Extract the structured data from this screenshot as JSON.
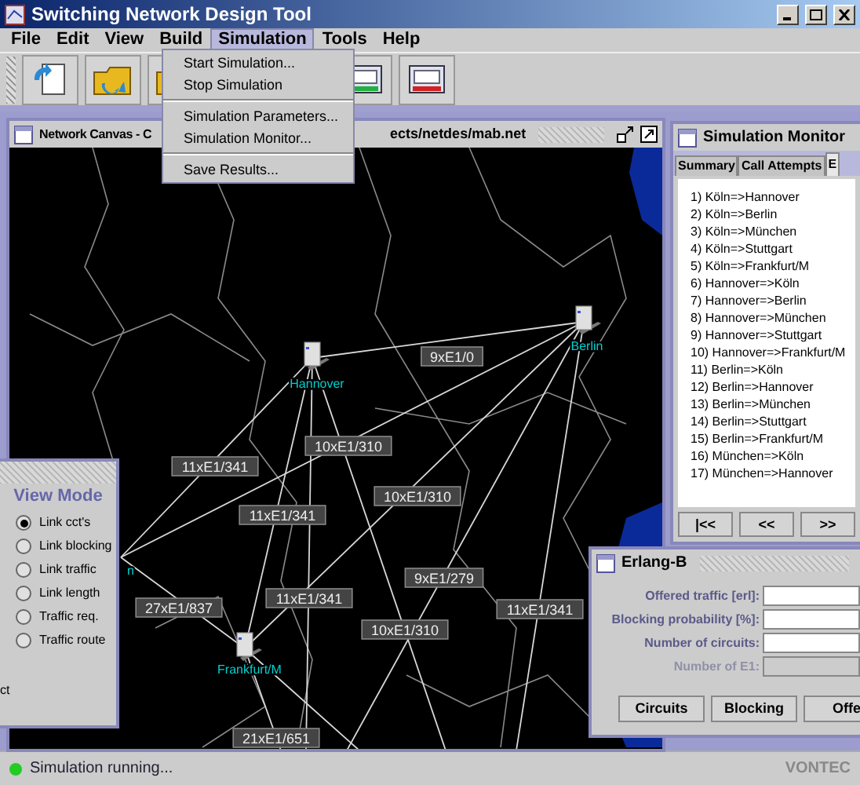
{
  "window": {
    "title": "Switching Network Design Tool"
  },
  "menu": [
    {
      "label": "File",
      "selected": false
    },
    {
      "label": "Edit",
      "selected": false
    },
    {
      "label": "View",
      "selected": false
    },
    {
      "label": "Build",
      "selected": false
    },
    {
      "label": "Simulation",
      "selected": true
    },
    {
      "label": "Tools",
      "selected": false
    },
    {
      "label": "Help",
      "selected": false
    }
  ],
  "open_menu": [
    {
      "kind": "item",
      "label": "Start Simulation..."
    },
    {
      "kind": "item",
      "label": "Stop Simulation"
    },
    {
      "kind": "separator"
    },
    {
      "kind": "item",
      "label": "Simulation Parameters..."
    },
    {
      "kind": "item",
      "label": "Simulation Monitor..."
    },
    {
      "kind": "separator"
    },
    {
      "kind": "item",
      "label": "Save Results..."
    }
  ],
  "canvas": {
    "title_start": "Network Canvas - C",
    "title_end": "ects/netdes/mab.net",
    "nodes": [
      {
        "label": "Hannover"
      },
      {
        "label": "Berlin"
      },
      {
        "label": "Frankfurt/M"
      },
      {
        "label": "n"
      }
    ],
    "links": [
      {
        "label": "9xE1/0"
      },
      {
        "label": "10xE1/310"
      },
      {
        "label": "11xE1/341"
      },
      {
        "label": "10xE1/310"
      },
      {
        "label": "11xE1/341"
      },
      {
        "label": "9xE1/279"
      },
      {
        "label": "27xE1/837"
      },
      {
        "label": "11xE1/341"
      },
      {
        "label": "11xE1/341"
      },
      {
        "label": "10xE1/310"
      },
      {
        "label": "21xE1/651"
      }
    ]
  },
  "monitor": {
    "title": "Simulation Monitor",
    "tabs": [
      {
        "label": "Summary",
        "selected": false
      },
      {
        "label": "Call Attempts",
        "selected": false
      },
      {
        "label": "E",
        "selected": true
      }
    ],
    "routes": [
      "1) Köln=>Hannover",
      "2) Köln=>Berlin",
      "3) Köln=>München",
      "4) Köln=>Stuttgart",
      "5) Köln=>Frankfurt/M",
      "6) Hannover=>Köln",
      "7) Hannover=>Berlin",
      "8) Hannover=>München",
      "9) Hannover=>Stuttgart",
      "10) Hannover=>Frankfurt/M",
      "11) Berlin=>Köln",
      "12) Berlin=>Hannover",
      "13) Berlin=>München",
      "14) Berlin=>Stuttgart",
      "15) Berlin=>Frankfurt/M",
      "16) München=>Köln",
      "17) München=>Hannover"
    ],
    "nav_buttons": [
      "|<<",
      "<<",
      ">>"
    ]
  },
  "view_mode": {
    "title": "View Mode",
    "options": [
      {
        "label": "Link cct's",
        "selected": true
      },
      {
        "label": "Link blocking",
        "selected": false
      },
      {
        "label": "Link traffic",
        "selected": false
      },
      {
        "label": "Link length",
        "selected": false
      },
      {
        "label": "Traffic req.",
        "selected": false
      },
      {
        "label": "Traffic route",
        "selected": false
      }
    ],
    "footer": "ct"
  },
  "erlang": {
    "title": "Erlang-B",
    "fields": [
      {
        "label": "Offered traffic [erl]:",
        "disabled": false
      },
      {
        "label": "Blocking probability [%]:",
        "disabled": false
      },
      {
        "label": "Number of circuits:",
        "disabled": false
      },
      {
        "label": "Number of E1:",
        "disabled": true
      }
    ],
    "buttons": [
      "Circuits",
      "Blocking",
      "Offe"
    ]
  },
  "status_bar": {
    "running": true,
    "message": "Simulation running...",
    "brand": "VONTEC"
  }
}
